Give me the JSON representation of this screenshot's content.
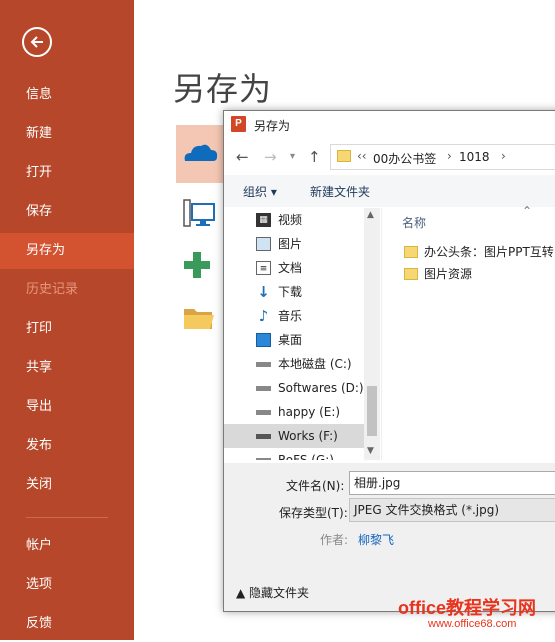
{
  "sidebar": {
    "items": [
      {
        "label": "信息"
      },
      {
        "label": "新建"
      },
      {
        "label": "打开"
      },
      {
        "label": "保存"
      },
      {
        "label": "另存为"
      },
      {
        "label": "历史记录"
      },
      {
        "label": "打印"
      },
      {
        "label": "共享"
      },
      {
        "label": "导出"
      },
      {
        "label": "发布"
      },
      {
        "label": "关闭"
      },
      {
        "label": "帐户"
      },
      {
        "label": "选项"
      },
      {
        "label": "反馈"
      }
    ],
    "colors": {
      "background": "#b7472a",
      "active": "#d35230"
    }
  },
  "main": {
    "title": "另存为",
    "locations": [
      "onedrive-icon",
      "this-pc-icon",
      "add-place-icon",
      "browse-folder-icon"
    ]
  },
  "dialog": {
    "app_icon_text": "P",
    "title": "另存为",
    "breadcrumb": [
      "‹‹",
      "00办公书签",
      "›",
      "1018",
      "›"
    ],
    "toolbar": {
      "organize": "组织 ▾",
      "new_folder": "新建文件夹"
    },
    "nav_tree": [
      {
        "label": "视频",
        "icon": "video-icon"
      },
      {
        "label": "图片",
        "icon": "pictures-icon"
      },
      {
        "label": "文档",
        "icon": "documents-icon"
      },
      {
        "label": "下载",
        "icon": "download-icon"
      },
      {
        "label": "音乐",
        "icon": "music-icon"
      },
      {
        "label": "桌面",
        "icon": "desktop-icon"
      },
      {
        "label": "本地磁盘 (C:)",
        "icon": "drive-icon"
      },
      {
        "label": "Softwares (D:)",
        "icon": "drive-icon"
      },
      {
        "label": "happy (E:)",
        "icon": "drive-icon"
      },
      {
        "label": "Works (F:)",
        "icon": "drive-icon",
        "selected": true
      },
      {
        "label": "RoFS (G:)",
        "icon": "drive-icon"
      }
    ],
    "files": {
      "column_name": "名称",
      "items": [
        "办公头条：图片PPT互转",
        "图片资源"
      ]
    },
    "form": {
      "filename_label": "文件名(N):",
      "filename_value": "相册.jpg",
      "filetype_label": "保存类型(T):",
      "filetype_value": "JPEG 文件交换格式 (*.jpg)",
      "author_label": "作者:",
      "author_value": "柳黎飞"
    },
    "hide_folders": "▲ 隐藏文件夹"
  },
  "watermark": {
    "text": "office教程学习网",
    "url": "www.office68.com"
  }
}
